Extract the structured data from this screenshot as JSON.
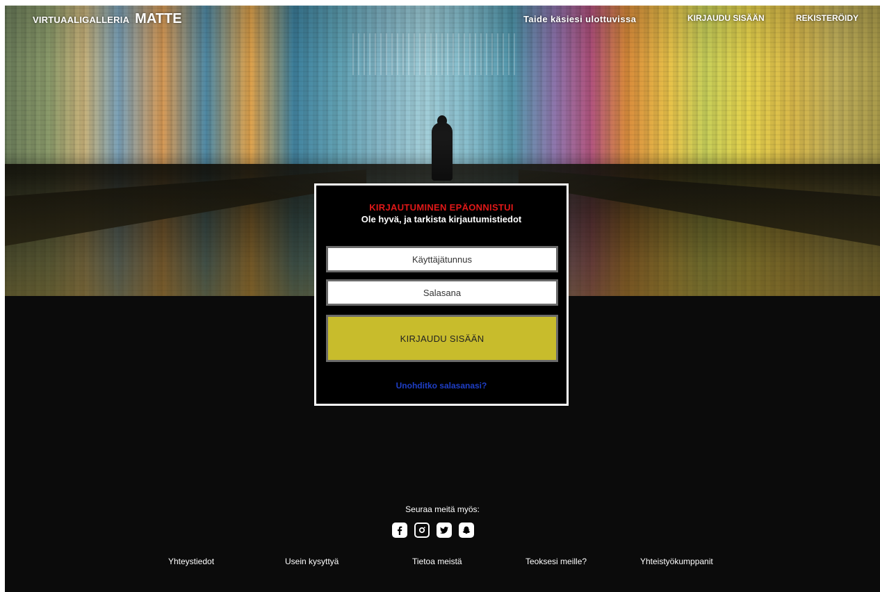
{
  "header": {
    "brand_prefix": "VIRTUAALIGALLERIA",
    "brand_name": "MATTE",
    "tagline": "Taide käsiesi ulottuvissa",
    "login_label": "KIRJAUDU SISÄÄN",
    "register_label": "REKISTERÖIDY"
  },
  "login": {
    "error_title": "KIRJAUTUMINEN EPÄONNISTUI",
    "error_message": "Ole hyvä, ja tarkista kirjautumistiedot",
    "username_placeholder": "Käyttäjätunnus",
    "password_placeholder": "Salasana",
    "submit_label": "KIRJAUDU SISÄÄN",
    "forgot_label": "Unohditko salasanasi?"
  },
  "footer": {
    "follow_label": "Seuraa meitä myös:",
    "socials": [
      "facebook-icon",
      "instagram-icon",
      "twitter-icon",
      "snapchat-icon"
    ],
    "links": [
      "Yhteystiedot",
      "Usein kysyttyä",
      "Tietoa meistä",
      "Teoksesi meille?",
      "Yhteistyökumppanit"
    ]
  },
  "colors": {
    "background": "#0b0b0b",
    "error": "#e01818",
    "submit": "#c8bc2c",
    "link": "#1f3fc8"
  }
}
